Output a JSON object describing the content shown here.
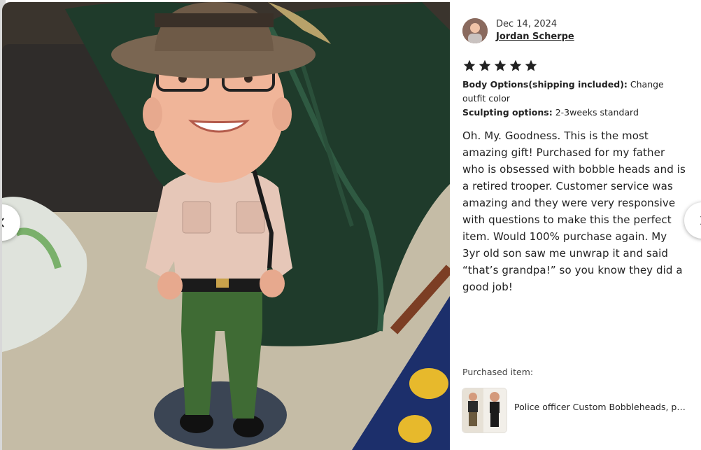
{
  "review": {
    "date": "Dec 14, 2024",
    "reviewer_name": "Jordan Scherpe",
    "rating": 5,
    "options": [
      {
        "label": "Body Options(shipping included):",
        "value": "Change outfit color"
      },
      {
        "label": "Sculpting options:",
        "value": "2-3weeks standard"
      }
    ],
    "text": "Oh. My. Goodness. This is the most amazing gift! Purchased for my father who is obsessed with bobble heads and is a retired trooper. Customer service was amazing and they were very responsive with questions to make this the perfect item. Would 100% purchase again. My 3yr old son saw me unwrap it and said “that’s grandpa!” so you know they did a good job!"
  },
  "purchased": {
    "label": "Purchased item:",
    "item_title": "Police officer Custom Bobbleheads, personalized police bobblehead gift"
  },
  "nav": {
    "prev_icon": "chevron-left-icon",
    "next_icon": "chevron-right-icon"
  },
  "colors": {
    "star": "#222222",
    "panel_bg": "#ffffff",
    "uniform_shirt": "#e6c7b8",
    "uniform_pants": "#3f6b34",
    "hat": "#7a6652"
  }
}
